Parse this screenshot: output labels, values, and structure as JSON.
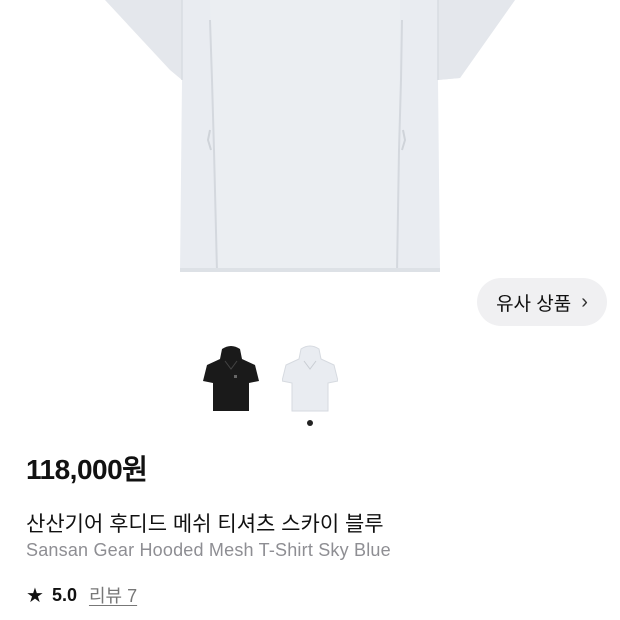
{
  "similar_button": {
    "label": "유사 상품",
    "icon": "chevron-right-icon",
    "chevron": "›"
  },
  "gallery": {
    "thumbnail_count": 2,
    "active_index": 0,
    "colors": [
      "#1a1a1a",
      "#e9ecf1"
    ]
  },
  "product": {
    "price": "118,000원",
    "name_ko": "산산기어 후디드 메쉬 티셔츠 스카이 블루",
    "name_en": "Sansan Gear Hooded Mesh T-Shirt Sky Blue",
    "rating": "5.0",
    "review_link": "리뷰 7"
  },
  "colors": {
    "shirt": "#e9ecf1",
    "accent": "#111111",
    "muted": "#8e8e93"
  }
}
